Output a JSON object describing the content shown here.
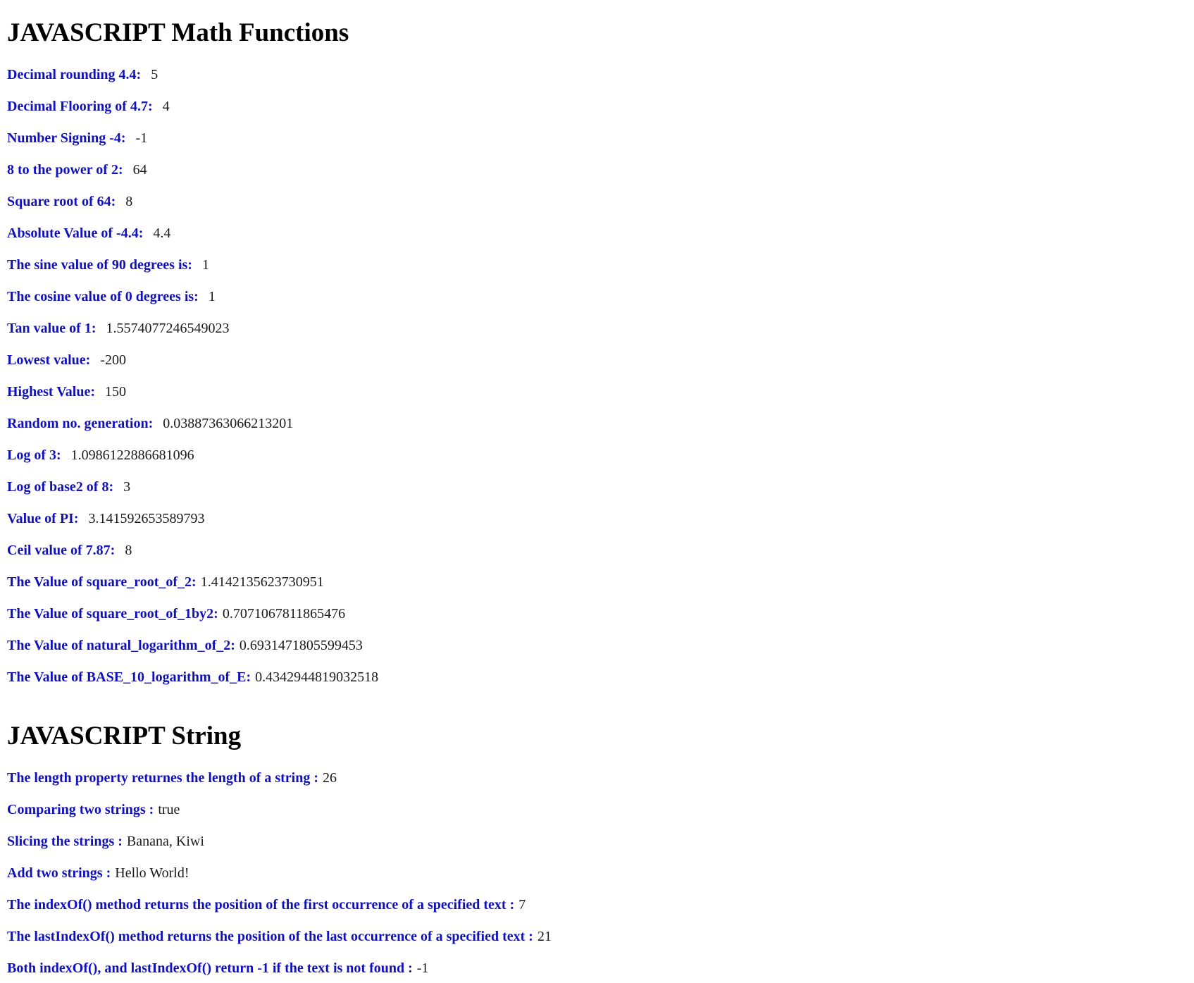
{
  "math": {
    "heading": "JAVASCRIPT Math Functions",
    "rows": [
      {
        "label": "Decimal rounding 4.4:",
        "value": "5"
      },
      {
        "label": "Decimal Flooring of 4.7:",
        "value": "4"
      },
      {
        "label": "Number Signing -4:",
        "value": "-1"
      },
      {
        "label": "8 to the power of 2:",
        "value": "64"
      },
      {
        "label": "Square root of 64:",
        "value": "8"
      },
      {
        "label": "Absolute Value of -4.4:",
        "value": "4.4"
      },
      {
        "label": "The sine value of 90 degrees is:",
        "value": "1"
      },
      {
        "label": "The cosine value of 0 degrees is:",
        "value": "1"
      },
      {
        "label": "Tan value of 1:",
        "value": "1.5574077246549023"
      },
      {
        "label": "Lowest value:",
        "value": "-200"
      },
      {
        "label": "Highest Value:",
        "value": "150"
      },
      {
        "label": "Random no. generation:",
        "value": "0.03887363066213201"
      },
      {
        "label": "Log of 3:",
        "value": "1.0986122886681096"
      },
      {
        "label": "Log of base2 of 8:",
        "value": "3"
      },
      {
        "label": "Value of PI:",
        "value": "3.141592653589793"
      },
      {
        "label": "Ceil value of 7.87:",
        "value": "8"
      },
      {
        "label": "The Value of square_root_of_2:",
        "value": "1.4142135623730951"
      },
      {
        "label": "The Value of square_root_of_1by2:",
        "value": "0.7071067811865476"
      },
      {
        "label": "The Value of natural_logarithm_of_2:",
        "value": "0.6931471805599453"
      },
      {
        "label": "The Value of BASE_10_logarithm_of_E:",
        "value": "0.4342944819032518"
      }
    ]
  },
  "string": {
    "heading": "JAVASCRIPT String",
    "rows": [
      {
        "label": "The length property returnes the length of a string :",
        "value": "26"
      },
      {
        "label": "Comparing two strings :",
        "value": "true"
      },
      {
        "label": "Slicing the strings :",
        "value": "Banana, Kiwi"
      },
      {
        "label": "Add two strings :",
        "value": "Hello World!"
      },
      {
        "label": "The indexOf() method returns the position of the first occurrence of a specified text :",
        "value": "7"
      },
      {
        "label": "The lastIndexOf() method returns the position of the last occurrence of a specified text :",
        "value": "21"
      },
      {
        "label": "Both indexOf(), and lastIndexOf() return -1 if the text is not found :",
        "value": "-1"
      }
    ]
  }
}
